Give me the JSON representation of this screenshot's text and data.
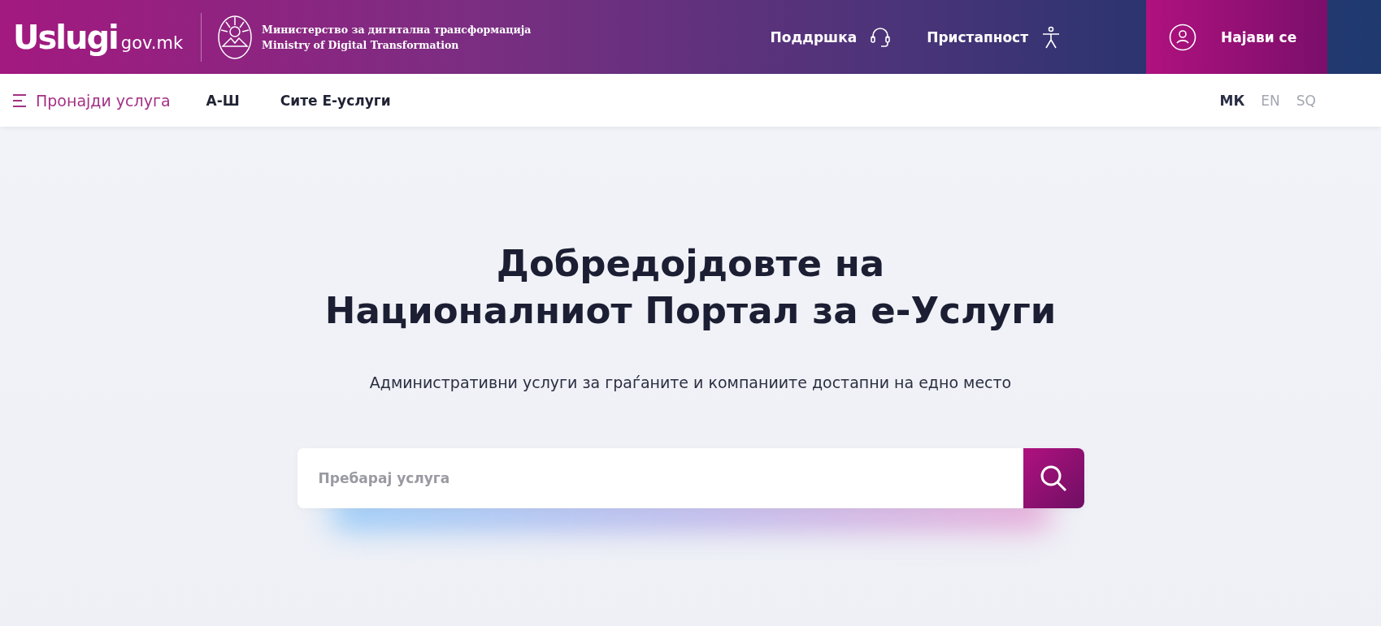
{
  "header": {
    "logo": {
      "name": "Uslugi",
      "domain": "gov.mk"
    },
    "ministry": [
      "Министерство за дигитална трансформација",
      "Ministry of Digital Transformation"
    ],
    "links": [
      {
        "kind": "support",
        "label": "Поддршка"
      },
      {
        "kind": "accessibility",
        "label": "Пристапност"
      }
    ],
    "login": {
      "label": "Најави се"
    }
  },
  "nav": {
    "menu": {
      "label": "Пронајди услуга"
    },
    "links": [
      "А-Ш",
      "Сите Е-услуги"
    ],
    "languages": [
      {
        "label": "МК",
        "selected": true
      },
      {
        "label": "EN",
        "selected": false
      },
      {
        "label": "SQ",
        "selected": false
      }
    ]
  },
  "hero": {
    "title": [
      "Добредојдовте на",
      "Националниот Портал за е-Услуги"
    ],
    "subtitle": "Административни услуги за граѓаните и компаниите достапни на едно место",
    "search": {
      "placeholder": "Пребарај услуга"
    }
  }
}
